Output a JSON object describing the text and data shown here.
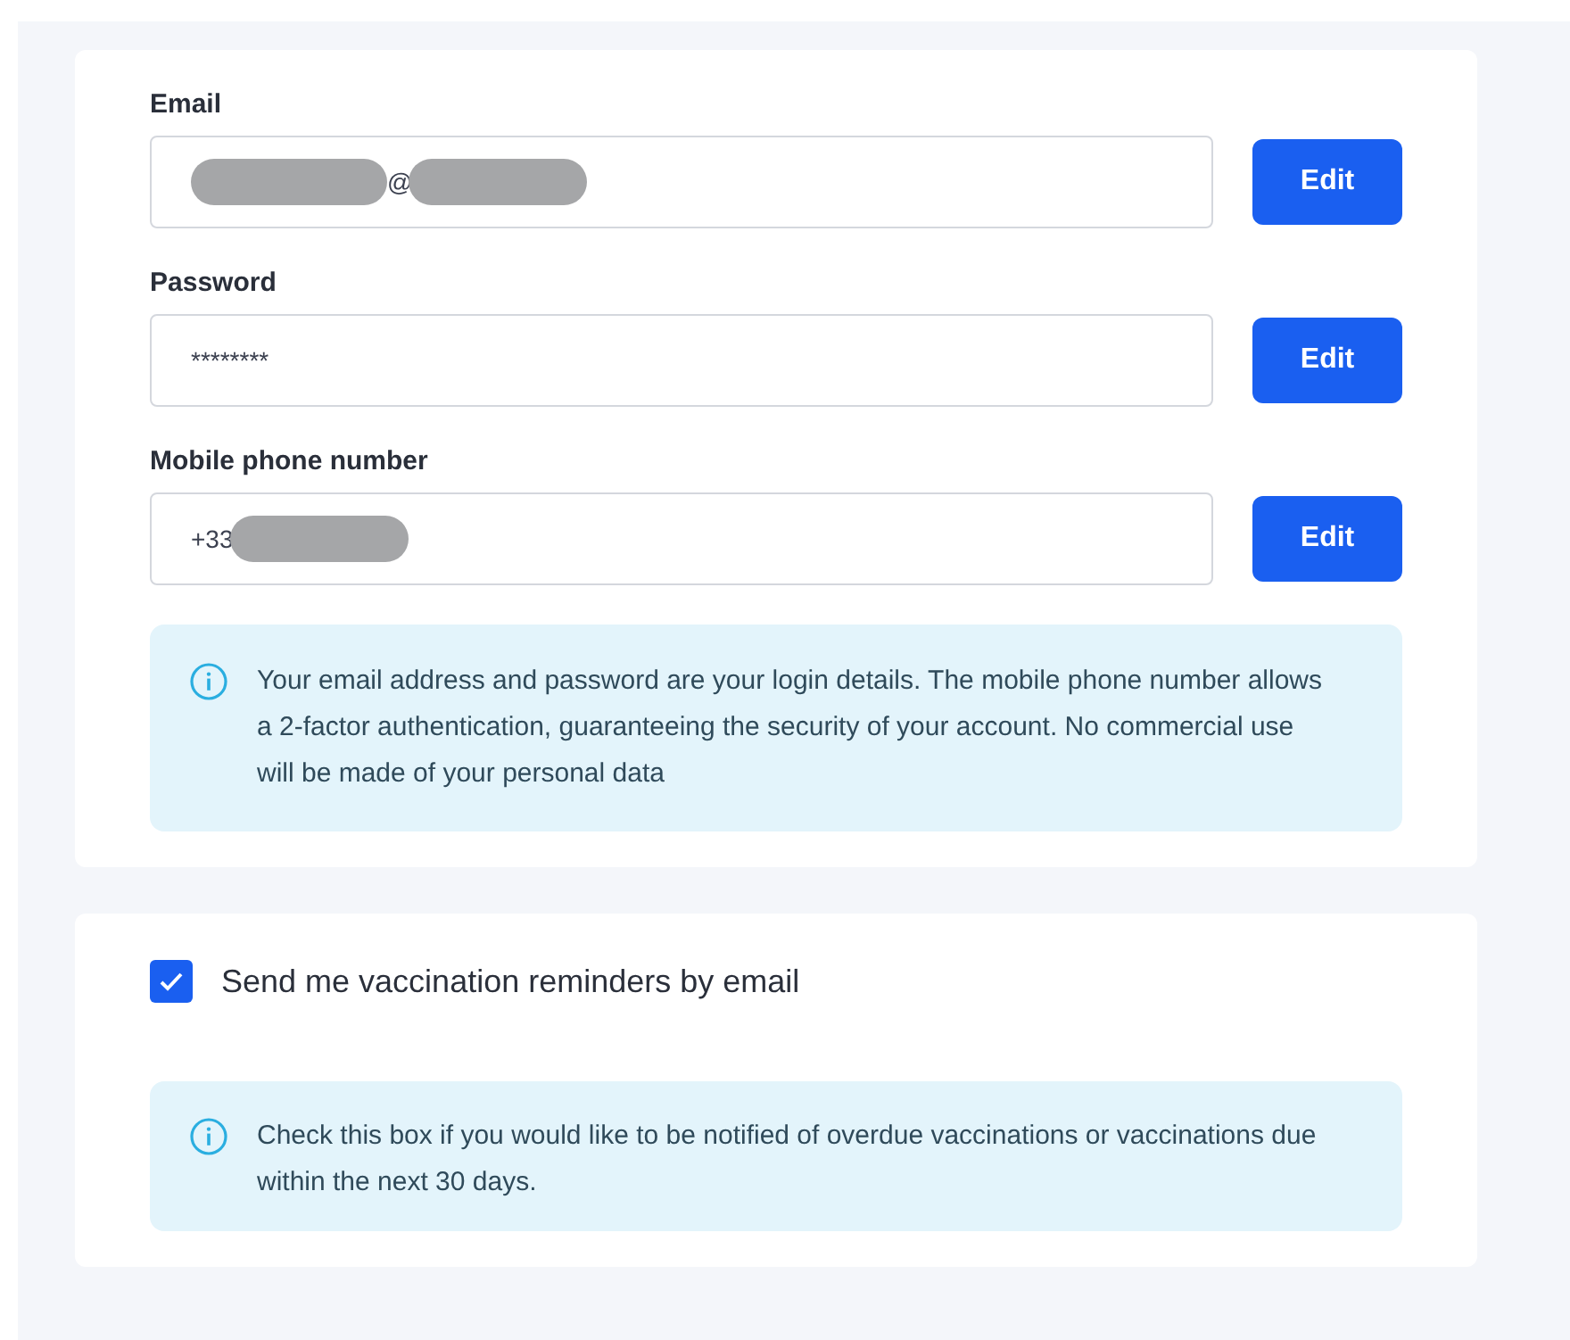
{
  "account": {
    "fields": [
      {
        "label": "Email",
        "value": "@",
        "redacted_before": true,
        "redacted_after": true,
        "button": "Edit"
      },
      {
        "label": "Password",
        "value": "********",
        "redacted_before": false,
        "redacted_after": false,
        "button": "Edit"
      },
      {
        "label": "Mobile phone number",
        "value": "+33",
        "redacted_before": false,
        "redacted_after": true,
        "button": "Edit"
      }
    ],
    "info": "Your email address and password are your login details. The mobile phone number allows a 2-factor authentication, guaranteeing the security of your account. No commercial use will be made of your personal data"
  },
  "reminders": {
    "checkbox": {
      "label": "Send me vaccination reminders by email",
      "checked": true
    },
    "info": "Check this box if you would like to be notified of overdue vaccinations or vaccinations due within the next 30 days."
  }
}
